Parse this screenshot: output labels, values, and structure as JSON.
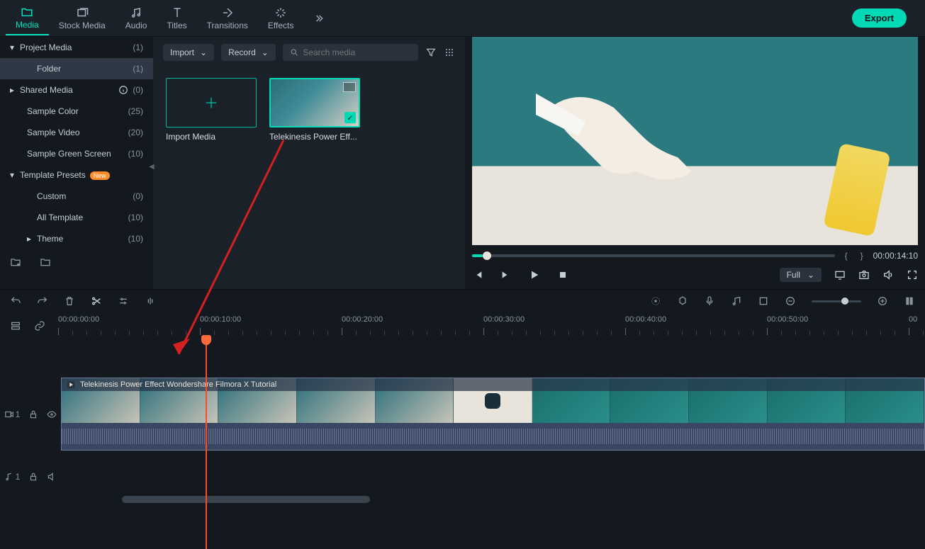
{
  "tabs": {
    "media": "Media",
    "stock": "Stock Media",
    "audio": "Audio",
    "titles": "Titles",
    "transitions": "Transitions",
    "effects": "Effects"
  },
  "export_label": "Export",
  "sidebar": {
    "project_media": {
      "label": "Project Media",
      "count": "(1)"
    },
    "folder": {
      "label": "Folder",
      "count": "(1)"
    },
    "shared_media": {
      "label": "Shared Media",
      "count": "(0)"
    },
    "sample_color": {
      "label": "Sample Color",
      "count": "(25)"
    },
    "sample_video": {
      "label": "Sample Video",
      "count": "(20)"
    },
    "sample_green": {
      "label": "Sample Green Screen",
      "count": "(10)"
    },
    "template_presets": {
      "label": "Template Presets",
      "badge": "New"
    },
    "custom": {
      "label": "Custom",
      "count": "(0)"
    },
    "all_template": {
      "label": "All Template",
      "count": "(10)"
    },
    "theme": {
      "label": "Theme",
      "count": "(10)"
    }
  },
  "media_toolbar": {
    "import": "Import",
    "record": "Record",
    "search_placeholder": "Search media"
  },
  "media_items": {
    "import_media": "Import Media",
    "clip1": "Telekinesis Power Eff..."
  },
  "preview": {
    "time": "00:00:14:10",
    "quality": "Full"
  },
  "timeline": {
    "ruler": [
      "00:00:00:00",
      "00:00:10:00",
      "00:00:20:00",
      "00:00:30:00",
      "00:00:40:00",
      "00:00:50:00",
      "00"
    ],
    "clip_title": "Telekinesis Power Effect   Wondershare Filmora X Tutorial",
    "video_track_label": "1",
    "audio_track_label": "1"
  }
}
